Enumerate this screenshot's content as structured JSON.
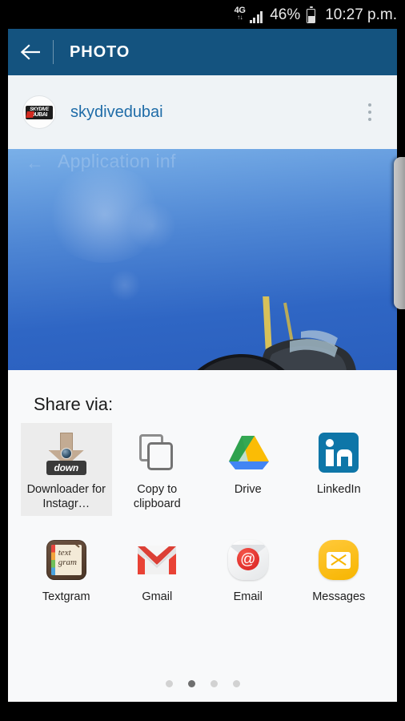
{
  "statusbar": {
    "network": "4G",
    "network_arrows": "↑↓",
    "battery_percent": "46%",
    "clock": "10:27 p.m.",
    "signal_icon": "signal-bars-icon",
    "battery_icon": "battery-icon"
  },
  "appbar": {
    "back_icon": "back-arrow-icon",
    "title": "PHOTO",
    "background_color": "#14537f"
  },
  "user_row": {
    "avatar_logo_line1": "SKYDIVE",
    "avatar_logo_line2": "DUBAI",
    "username": "skydivedubai",
    "username_color": "#1f6ca8",
    "overflow_icon": "more-vertical-icon"
  },
  "photo": {
    "ghost_overlay_text": "Application inf",
    "ghost_back_arrow": "←",
    "alt": "Tandem skydivers in helmet and goggles against blue sky with small airplane above"
  },
  "share_sheet": {
    "title": "Share via:",
    "apps": [
      {
        "label": "Downloader for Instagr…",
        "icon": "downloader-for-instagram-icon",
        "selected": true
      },
      {
        "label": "Copy to clipboard",
        "icon": "copy-to-clipboard-icon",
        "selected": false
      },
      {
        "label": "Drive",
        "icon": "google-drive-icon",
        "selected": false
      },
      {
        "label": "LinkedIn",
        "icon": "linkedin-icon",
        "selected": false
      },
      {
        "label": "Textgram",
        "icon": "textgram-icon",
        "selected": false
      },
      {
        "label": "Gmail",
        "icon": "gmail-icon",
        "selected": false
      },
      {
        "label": "Email",
        "icon": "email-at-icon",
        "selected": false
      },
      {
        "label": "Messages",
        "icon": "messages-envelope-icon",
        "selected": false
      }
    ],
    "downloader_badge_text": "down",
    "textgram_text_line1": "text",
    "textgram_text_line2": "gram",
    "linkedin_glyph": "in",
    "email_glyph": "@",
    "pagination": {
      "total": 4,
      "active_index": 1
    }
  },
  "edge_panel": {
    "handle_icon": "edge-panel-handle"
  }
}
